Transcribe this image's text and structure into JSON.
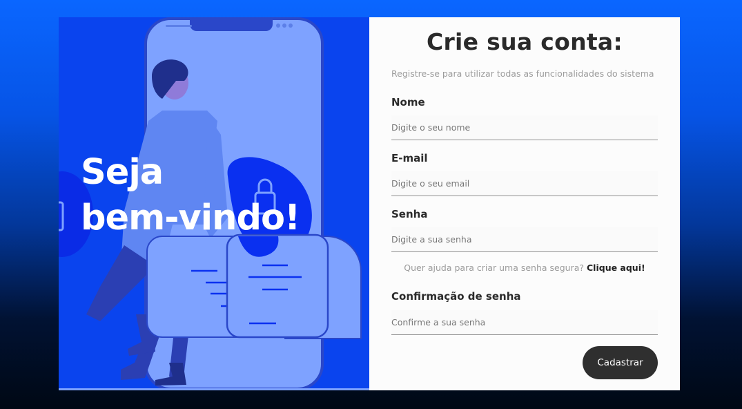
{
  "hero": {
    "line1": "Seja",
    "line2": "bem-vindo!"
  },
  "form": {
    "title": "Crie sua conta:",
    "subtitle": "Registre-se para utilizar todas as funcionalidades do sistema",
    "fields": [
      {
        "label": "Nome",
        "placeholder": "Digite o seu nome"
      },
      {
        "label": "E-mail",
        "placeholder": "Digite o seu email"
      },
      {
        "label": "Senha",
        "placeholder": "Digite a sua senha"
      },
      {
        "label": "Confirmação de senha",
        "placeholder": "Confirme a sua senha"
      }
    ],
    "help_text": "Quer ajuda para criar uma senha segura?",
    "help_link": "Clique aqui!",
    "submit_label": "Cadastrar"
  },
  "colors": {
    "background_top": "#0a66ff",
    "background_bottom": "#000814",
    "hero_panel": "#0a44ee",
    "illustration_light": "#7ea2ff",
    "button": "#2f2f2f"
  },
  "icons": [
    "phone-illustration",
    "person-illustration",
    "padlock-icon",
    "document-card-illustration"
  ]
}
